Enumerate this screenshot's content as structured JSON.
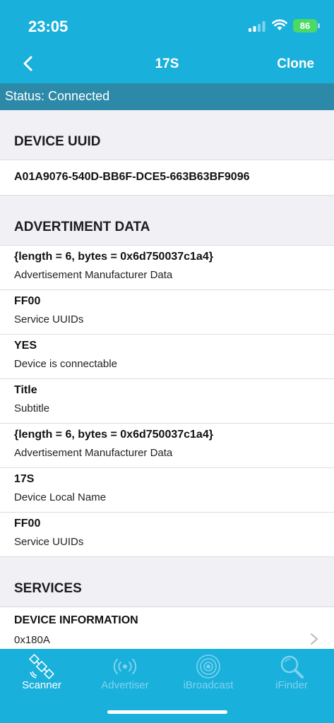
{
  "status_bar": {
    "time": "23:05",
    "battery": "86"
  },
  "nav": {
    "title": "17S",
    "clone_label": "Clone"
  },
  "connection_status": "Status: Connected",
  "device_uuid": {
    "header": "DEVICE UUID",
    "value": "A01A9076-540D-BB6F-DCE5-663B63BF9096"
  },
  "advertisement": {
    "header": "ADVERTIMENT DATA",
    "items": [
      {
        "value": "{length = 6, bytes = 0x6d750037c1a4}",
        "label": "Advertisement Manufacturer Data"
      },
      {
        "value": "FF00",
        "label": "Service UUIDs"
      },
      {
        "value": "YES",
        "label": "Device is connectable"
      },
      {
        "value": "Title",
        "label": "Subtitle"
      },
      {
        "value": "{length = 6, bytes = 0x6d750037c1a4}",
        "label": "Advertisement Manufacturer Data"
      },
      {
        "value": "17S",
        "label": "Device Local Name"
      },
      {
        "value": "FF00",
        "label": "Service UUIDs"
      }
    ]
  },
  "services": {
    "header": "SERVICES",
    "items": [
      {
        "name": "DEVICE INFORMATION",
        "uuid": "0x180A"
      }
    ]
  },
  "tabs": [
    {
      "label": "Scanner",
      "icon": "satellite-icon",
      "active": true
    },
    {
      "label": "Advertiser",
      "icon": "broadcast-icon",
      "active": false
    },
    {
      "label": "iBroadcast",
      "icon": "radar-icon",
      "active": false
    },
    {
      "label": "iFinder",
      "icon": "magnifier-icon",
      "active": false
    }
  ],
  "colors": {
    "accent": "#1ab0dc",
    "status_bar_bg": "#2c8aa8",
    "background": "#f0f0f5"
  }
}
